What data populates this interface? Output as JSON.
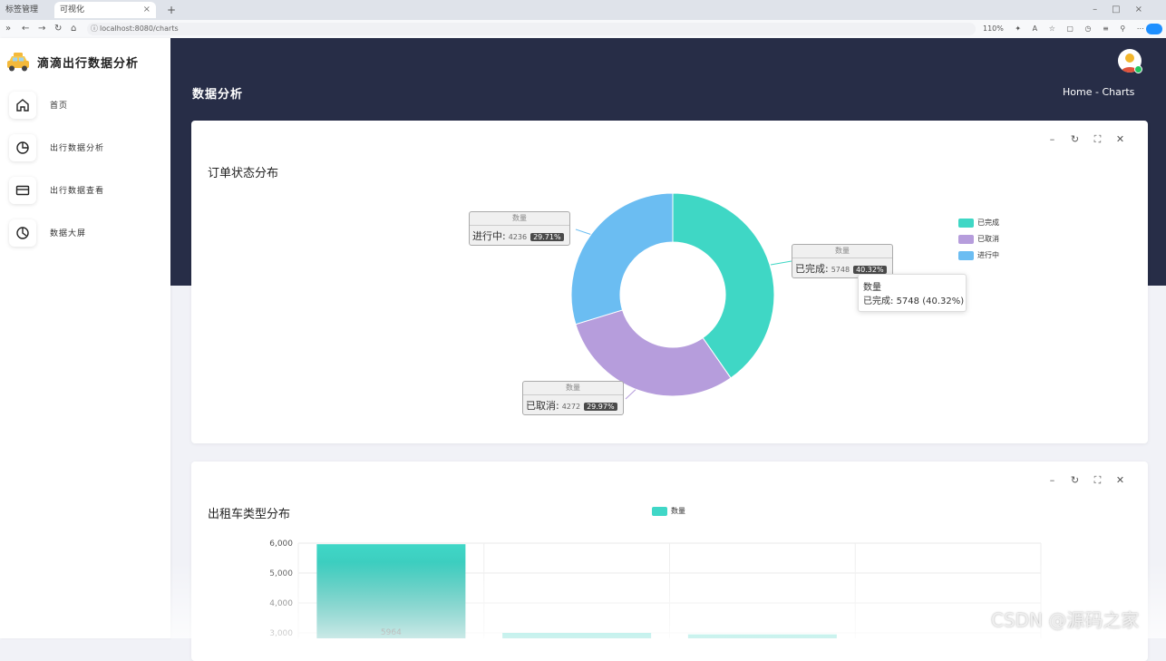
{
  "browser": {
    "tabs": [
      {
        "label": "标签管理",
        "active": false
      },
      {
        "label": "可视化",
        "active": true
      }
    ],
    "url": "localhost:8080/charts",
    "zoom": "110%"
  },
  "sidebar": {
    "app_title": "滴滴出行数据分析",
    "items": [
      {
        "label": "首页",
        "icon": "home-icon"
      },
      {
        "label": "出行数据分析",
        "icon": "pie-chart-icon"
      },
      {
        "label": "出行数据查看",
        "icon": "card-icon"
      },
      {
        "label": "数据大屏",
        "icon": "clock-pie-icon"
      }
    ]
  },
  "header": {
    "title": "数据分析",
    "breadcrumb": "Home  -  Charts"
  },
  "card_tools": [
    "–",
    "↻",
    "⛶",
    "✕"
  ],
  "colors": {
    "header_bg": "#272d47",
    "completed": "#3fd7c5",
    "cancelled": "#b69ddc",
    "in_progress": "#6bbdf2",
    "bar_top": "#40d7c7",
    "bar_bottom": "#2aa39a"
  },
  "chart_data": [
    {
      "type": "pie",
      "title": "订单状态分布",
      "series_name": "数量",
      "slices": [
        {
          "label": "已完成",
          "value": 5748,
          "percent": "40.32%"
        },
        {
          "label": "已取消",
          "value": 4272,
          "percent": "29.97%"
        },
        {
          "label": "进行中",
          "value": 4236,
          "percent": "29.71%"
        }
      ],
      "legend": [
        "已完成",
        "已取消",
        "进行中"
      ],
      "legend_position": "top-right",
      "label_boxes": [
        {
          "header": "数量",
          "name": "进行中:",
          "count": "4236",
          "pct": "29.71%"
        },
        {
          "header": "数量",
          "name": "已完成:",
          "count": "5748",
          "pct": "40.32%"
        },
        {
          "header": "数量",
          "name": "已取消:",
          "count": "4272",
          "pct": "29.97%"
        }
      ],
      "tooltip": {
        "title": "数量",
        "line_label": "已完成:",
        "line_value": "5748 (40.32%)"
      }
    },
    {
      "type": "bar",
      "title": "出租车类型分布",
      "legend": [
        "数量"
      ],
      "legend_position": "top-center",
      "y_ticks": [
        "6,000",
        "5,000",
        "4,000",
        "3,000"
      ],
      "ylim": [
        0,
        6000
      ],
      "values": [
        5964,
        3000,
        2950
      ],
      "data_labels": [
        "5964"
      ],
      "grid": true
    }
  ],
  "watermark": "CSDN @源码之家"
}
